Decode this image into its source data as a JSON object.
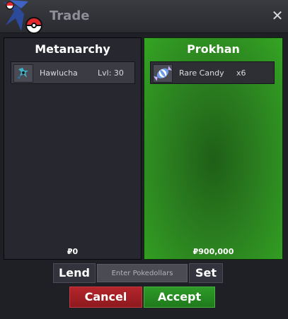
{
  "window": {
    "title": "Trade",
    "close_icon": "close-icon"
  },
  "left_panel": {
    "player": "Metanarchy",
    "item": {
      "icon": "hawlucha-sprite-icon",
      "name": "Hawlucha",
      "extra": "Lvl: 30"
    },
    "money": "₽0"
  },
  "right_panel": {
    "player": "Prokhan",
    "item": {
      "icon": "rare-candy-icon",
      "name": "Rare Candy",
      "extra": "x6"
    },
    "money": "₽900,000"
  },
  "controls": {
    "lend_label": "Lend",
    "pokedollars_placeholder": "Enter Pokedollars",
    "set_label": "Set",
    "cancel_label": "Cancel",
    "accept_label": "Accept"
  },
  "colors": {
    "accept_green": "#2e9a28",
    "cancel_red": "#b3252b",
    "panel_green": "#34a423"
  }
}
